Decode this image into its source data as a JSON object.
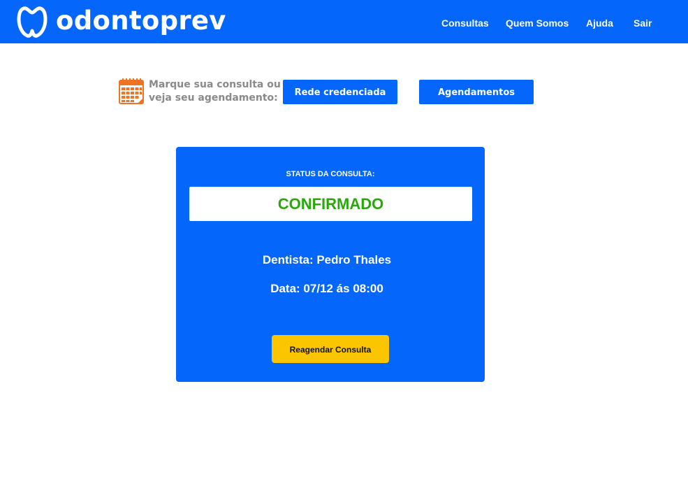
{
  "header": {
    "brand": "odontoprev",
    "nav": [
      {
        "label": "Consultas"
      },
      {
        "label": "Quem Somos"
      },
      {
        "label": "Ajuda"
      },
      {
        "label": "Sair"
      }
    ],
    "colors": {
      "bar": "#0566fc",
      "text": "#ffffff"
    }
  },
  "actions": {
    "prompt_line1": "Marque sua consulta ou",
    "prompt_line2": "veja seu agendamento:",
    "rede_button": "Rede credenciada",
    "agendamentos_button": "Agendamentos",
    "icon": "calendar-icon"
  },
  "appointment": {
    "status_label": "STATUS DA CONSULTA:",
    "status_value": "CONFIRMADO",
    "dentist": "Dentista: Pedro Thales",
    "date": "Data: 07/12 ás 08:00",
    "reschedule_button": "Reagendar Consulta",
    "colors": {
      "card": "#0566fc",
      "status": "#2aa70c",
      "button": "#fbc600"
    }
  }
}
